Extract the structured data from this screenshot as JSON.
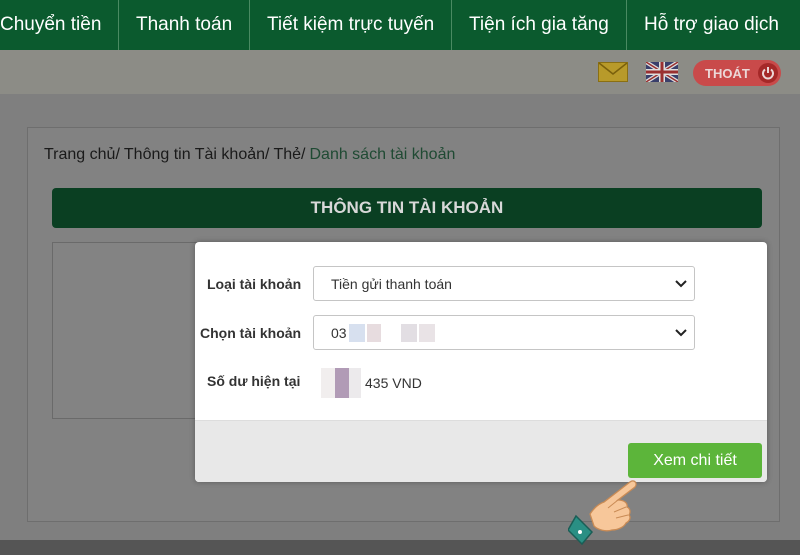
{
  "nav": {
    "items": [
      "Chuyển tiền",
      "Thanh toán",
      "Tiết kiệm trực tuyến",
      "Tiện ích gia tăng",
      "Hỗ trợ giao dịch"
    ]
  },
  "header": {
    "logout_label": "THOÁT",
    "icons": [
      "mail-icon",
      "uk-flag-icon",
      "power-icon"
    ]
  },
  "breadcrumb": {
    "home": "Trang chủ/",
    "account": "Thông tin Tài khoản/",
    "card": "Thẻ/",
    "current": "Danh sách tài khoản"
  },
  "section": {
    "title": "THÔNG TIN TÀI KHOẢN"
  },
  "modal": {
    "account_type_label": "Loại tài khoản",
    "account_type_value": "Tiền gửi thanh toán",
    "choose_account_label": "Chọn tài khoản",
    "choose_account_value": "03",
    "balance_label": "Số dư hiện tại",
    "balance_value": "435 VND",
    "detail_button": "Xem chi tiết"
  },
  "colors": {
    "nav_bg": "#0b5a2e",
    "header_bar": "#0a3f22",
    "button_green": "#5cb53a",
    "logout_red": "#c94a4a"
  }
}
